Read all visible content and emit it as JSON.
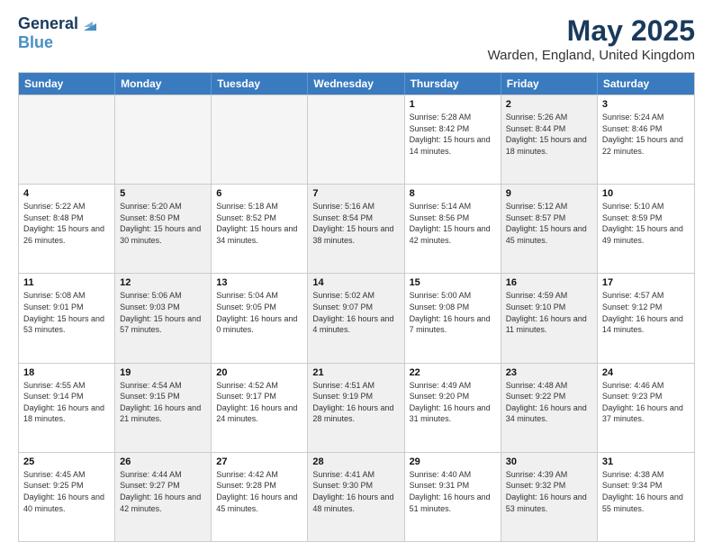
{
  "header": {
    "logo_line1": "General",
    "logo_line2": "Blue",
    "month_title": "May 2025",
    "location": "Warden, England, United Kingdom"
  },
  "days_of_week": [
    "Sunday",
    "Monday",
    "Tuesday",
    "Wednesday",
    "Thursday",
    "Friday",
    "Saturday"
  ],
  "rows": [
    [
      {
        "day": "",
        "info": "",
        "empty": true
      },
      {
        "day": "",
        "info": "",
        "empty": true
      },
      {
        "day": "",
        "info": "",
        "empty": true
      },
      {
        "day": "",
        "info": "",
        "empty": true
      },
      {
        "day": "1",
        "info": "Sunrise: 5:28 AM\nSunset: 8:42 PM\nDaylight: 15 hours\nand 14 minutes.",
        "empty": false,
        "shaded": false
      },
      {
        "day": "2",
        "info": "Sunrise: 5:26 AM\nSunset: 8:44 PM\nDaylight: 15 hours\nand 18 minutes.",
        "empty": false,
        "shaded": true
      },
      {
        "day": "3",
        "info": "Sunrise: 5:24 AM\nSunset: 8:46 PM\nDaylight: 15 hours\nand 22 minutes.",
        "empty": false,
        "shaded": false
      }
    ],
    [
      {
        "day": "4",
        "info": "Sunrise: 5:22 AM\nSunset: 8:48 PM\nDaylight: 15 hours\nand 26 minutes.",
        "empty": false,
        "shaded": false
      },
      {
        "day": "5",
        "info": "Sunrise: 5:20 AM\nSunset: 8:50 PM\nDaylight: 15 hours\nand 30 minutes.",
        "empty": false,
        "shaded": true
      },
      {
        "day": "6",
        "info": "Sunrise: 5:18 AM\nSunset: 8:52 PM\nDaylight: 15 hours\nand 34 minutes.",
        "empty": false,
        "shaded": false
      },
      {
        "day": "7",
        "info": "Sunrise: 5:16 AM\nSunset: 8:54 PM\nDaylight: 15 hours\nand 38 minutes.",
        "empty": false,
        "shaded": true
      },
      {
        "day": "8",
        "info": "Sunrise: 5:14 AM\nSunset: 8:56 PM\nDaylight: 15 hours\nand 42 minutes.",
        "empty": false,
        "shaded": false
      },
      {
        "day": "9",
        "info": "Sunrise: 5:12 AM\nSunset: 8:57 PM\nDaylight: 15 hours\nand 45 minutes.",
        "empty": false,
        "shaded": true
      },
      {
        "day": "10",
        "info": "Sunrise: 5:10 AM\nSunset: 8:59 PM\nDaylight: 15 hours\nand 49 minutes.",
        "empty": false,
        "shaded": false
      }
    ],
    [
      {
        "day": "11",
        "info": "Sunrise: 5:08 AM\nSunset: 9:01 PM\nDaylight: 15 hours\nand 53 minutes.",
        "empty": false,
        "shaded": false
      },
      {
        "day": "12",
        "info": "Sunrise: 5:06 AM\nSunset: 9:03 PM\nDaylight: 15 hours\nand 57 minutes.",
        "empty": false,
        "shaded": true
      },
      {
        "day": "13",
        "info": "Sunrise: 5:04 AM\nSunset: 9:05 PM\nDaylight: 16 hours\nand 0 minutes.",
        "empty": false,
        "shaded": false
      },
      {
        "day": "14",
        "info": "Sunrise: 5:02 AM\nSunset: 9:07 PM\nDaylight: 16 hours\nand 4 minutes.",
        "empty": false,
        "shaded": true
      },
      {
        "day": "15",
        "info": "Sunrise: 5:00 AM\nSunset: 9:08 PM\nDaylight: 16 hours\nand 7 minutes.",
        "empty": false,
        "shaded": false
      },
      {
        "day": "16",
        "info": "Sunrise: 4:59 AM\nSunset: 9:10 PM\nDaylight: 16 hours\nand 11 minutes.",
        "empty": false,
        "shaded": true
      },
      {
        "day": "17",
        "info": "Sunrise: 4:57 AM\nSunset: 9:12 PM\nDaylight: 16 hours\nand 14 minutes.",
        "empty": false,
        "shaded": false
      }
    ],
    [
      {
        "day": "18",
        "info": "Sunrise: 4:55 AM\nSunset: 9:14 PM\nDaylight: 16 hours\nand 18 minutes.",
        "empty": false,
        "shaded": false
      },
      {
        "day": "19",
        "info": "Sunrise: 4:54 AM\nSunset: 9:15 PM\nDaylight: 16 hours\nand 21 minutes.",
        "empty": false,
        "shaded": true
      },
      {
        "day": "20",
        "info": "Sunrise: 4:52 AM\nSunset: 9:17 PM\nDaylight: 16 hours\nand 24 minutes.",
        "empty": false,
        "shaded": false
      },
      {
        "day": "21",
        "info": "Sunrise: 4:51 AM\nSunset: 9:19 PM\nDaylight: 16 hours\nand 28 minutes.",
        "empty": false,
        "shaded": true
      },
      {
        "day": "22",
        "info": "Sunrise: 4:49 AM\nSunset: 9:20 PM\nDaylight: 16 hours\nand 31 minutes.",
        "empty": false,
        "shaded": false
      },
      {
        "day": "23",
        "info": "Sunrise: 4:48 AM\nSunset: 9:22 PM\nDaylight: 16 hours\nand 34 minutes.",
        "empty": false,
        "shaded": true
      },
      {
        "day": "24",
        "info": "Sunrise: 4:46 AM\nSunset: 9:23 PM\nDaylight: 16 hours\nand 37 minutes.",
        "empty": false,
        "shaded": false
      }
    ],
    [
      {
        "day": "25",
        "info": "Sunrise: 4:45 AM\nSunset: 9:25 PM\nDaylight: 16 hours\nand 40 minutes.",
        "empty": false,
        "shaded": false
      },
      {
        "day": "26",
        "info": "Sunrise: 4:44 AM\nSunset: 9:27 PM\nDaylight: 16 hours\nand 42 minutes.",
        "empty": false,
        "shaded": true
      },
      {
        "day": "27",
        "info": "Sunrise: 4:42 AM\nSunset: 9:28 PM\nDaylight: 16 hours\nand 45 minutes.",
        "empty": false,
        "shaded": false
      },
      {
        "day": "28",
        "info": "Sunrise: 4:41 AM\nSunset: 9:30 PM\nDaylight: 16 hours\nand 48 minutes.",
        "empty": false,
        "shaded": true
      },
      {
        "day": "29",
        "info": "Sunrise: 4:40 AM\nSunset: 9:31 PM\nDaylight: 16 hours\nand 51 minutes.",
        "empty": false,
        "shaded": false
      },
      {
        "day": "30",
        "info": "Sunrise: 4:39 AM\nSunset: 9:32 PM\nDaylight: 16 hours\nand 53 minutes.",
        "empty": false,
        "shaded": true
      },
      {
        "day": "31",
        "info": "Sunrise: 4:38 AM\nSunset: 9:34 PM\nDaylight: 16 hours\nand 55 minutes.",
        "empty": false,
        "shaded": false
      }
    ]
  ]
}
